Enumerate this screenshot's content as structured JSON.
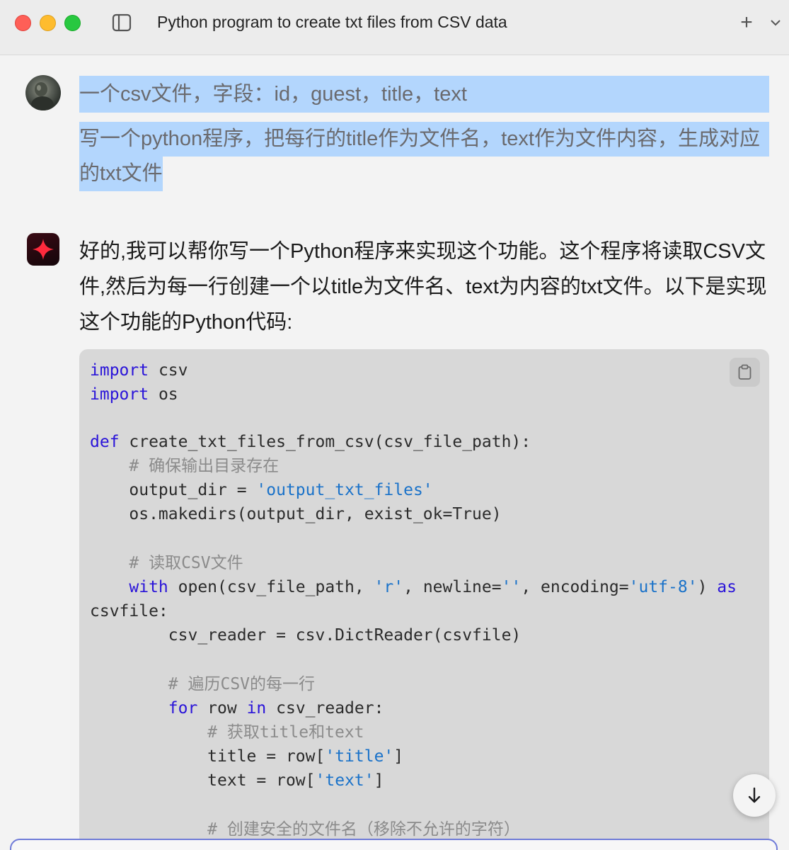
{
  "window": {
    "title": "Python program to create txt files from CSV data"
  },
  "titlebar": {
    "new_tab_symbol": "+",
    "icons": [
      "sidebar-toggle-icon",
      "plus-icon",
      "chevron-down-icon"
    ]
  },
  "user_message": {
    "avatar": "user-avatar",
    "lines": [
      "一个csv文件，字段：id，guest，title，text",
      "写一个python程序，把每行的title作为文件名，text作为文件内容，生成对应",
      "的txt文件"
    ],
    "highlight_color": "#b3d6fd"
  },
  "assistant_message": {
    "avatar": "sparkle-icon",
    "lines": [
      "好的,我可以帮你写一个Python程序来实现这个功能。这个程序将读取CSV文",
      "件,然后为每一行创建一个以title为文件名、text为内容的txt文件。以下是实现",
      "这个功能的Python代码:"
    ]
  },
  "code_block": {
    "copy_icon": "clipboard-icon",
    "colors": {
      "keyword": "#2a14d9",
      "string": "#1a72c9",
      "comment": "#8b8b8b",
      "background": "#d8d8d8"
    },
    "lines": [
      [
        {
          "t": "import",
          "k": "kw"
        },
        {
          "t": " csv",
          "k": ""
        }
      ],
      [
        {
          "t": "import",
          "k": "kw"
        },
        {
          "t": " os",
          "k": ""
        }
      ],
      [],
      [
        {
          "t": "def",
          "k": "kw"
        },
        {
          "t": " create_txt_files_from_csv(csv_file_path):",
          "k": ""
        }
      ],
      [
        {
          "t": "    # 确保输出目录存在",
          "k": "cmt"
        }
      ],
      [
        {
          "t": "    output_dir = ",
          "k": ""
        },
        {
          "t": "'output_txt_files'",
          "k": "str"
        }
      ],
      [
        {
          "t": "    os.makedirs(output_dir, exist_ok=True)",
          "k": ""
        }
      ],
      [],
      [
        {
          "t": "    # 读取CSV文件",
          "k": "cmt"
        }
      ],
      [
        {
          "t": "    ",
          "k": ""
        },
        {
          "t": "with",
          "k": "kw"
        },
        {
          "t": " open(csv_file_path, ",
          "k": ""
        },
        {
          "t": "'r'",
          "k": "str"
        },
        {
          "t": ", newline=",
          "k": ""
        },
        {
          "t": "''",
          "k": "str"
        },
        {
          "t": ", encoding=",
          "k": ""
        },
        {
          "t": "'utf-8'",
          "k": "str"
        },
        {
          "t": ") ",
          "k": ""
        },
        {
          "t": "as",
          "k": "kw"
        }
      ],
      [
        {
          "t": "csvfile:",
          "k": ""
        }
      ],
      [
        {
          "t": "        csv_reader = csv.DictReader(csvfile)",
          "k": ""
        }
      ],
      [],
      [
        {
          "t": "        # 遍历CSV的每一行",
          "k": "cmt"
        }
      ],
      [
        {
          "t": "        ",
          "k": ""
        },
        {
          "t": "for",
          "k": "kw"
        },
        {
          "t": " row ",
          "k": ""
        },
        {
          "t": "in",
          "k": "kw"
        },
        {
          "t": " csv_reader:",
          "k": ""
        }
      ],
      [
        {
          "t": "            # 获取title和text",
          "k": "cmt"
        }
      ],
      [
        {
          "t": "            title = row[",
          "k": ""
        },
        {
          "t": "'title'",
          "k": "str"
        },
        {
          "t": "]",
          "k": ""
        }
      ],
      [
        {
          "t": "            text = row[",
          "k": ""
        },
        {
          "t": "'text'",
          "k": "str"
        },
        {
          "t": "]",
          "k": ""
        }
      ],
      [],
      [
        {
          "t": "            # 创建安全的文件名（移除不允许的字符）",
          "k": "cmt"
        }
      ]
    ]
  },
  "scroll_down": {
    "icon": "arrow-down-icon"
  }
}
